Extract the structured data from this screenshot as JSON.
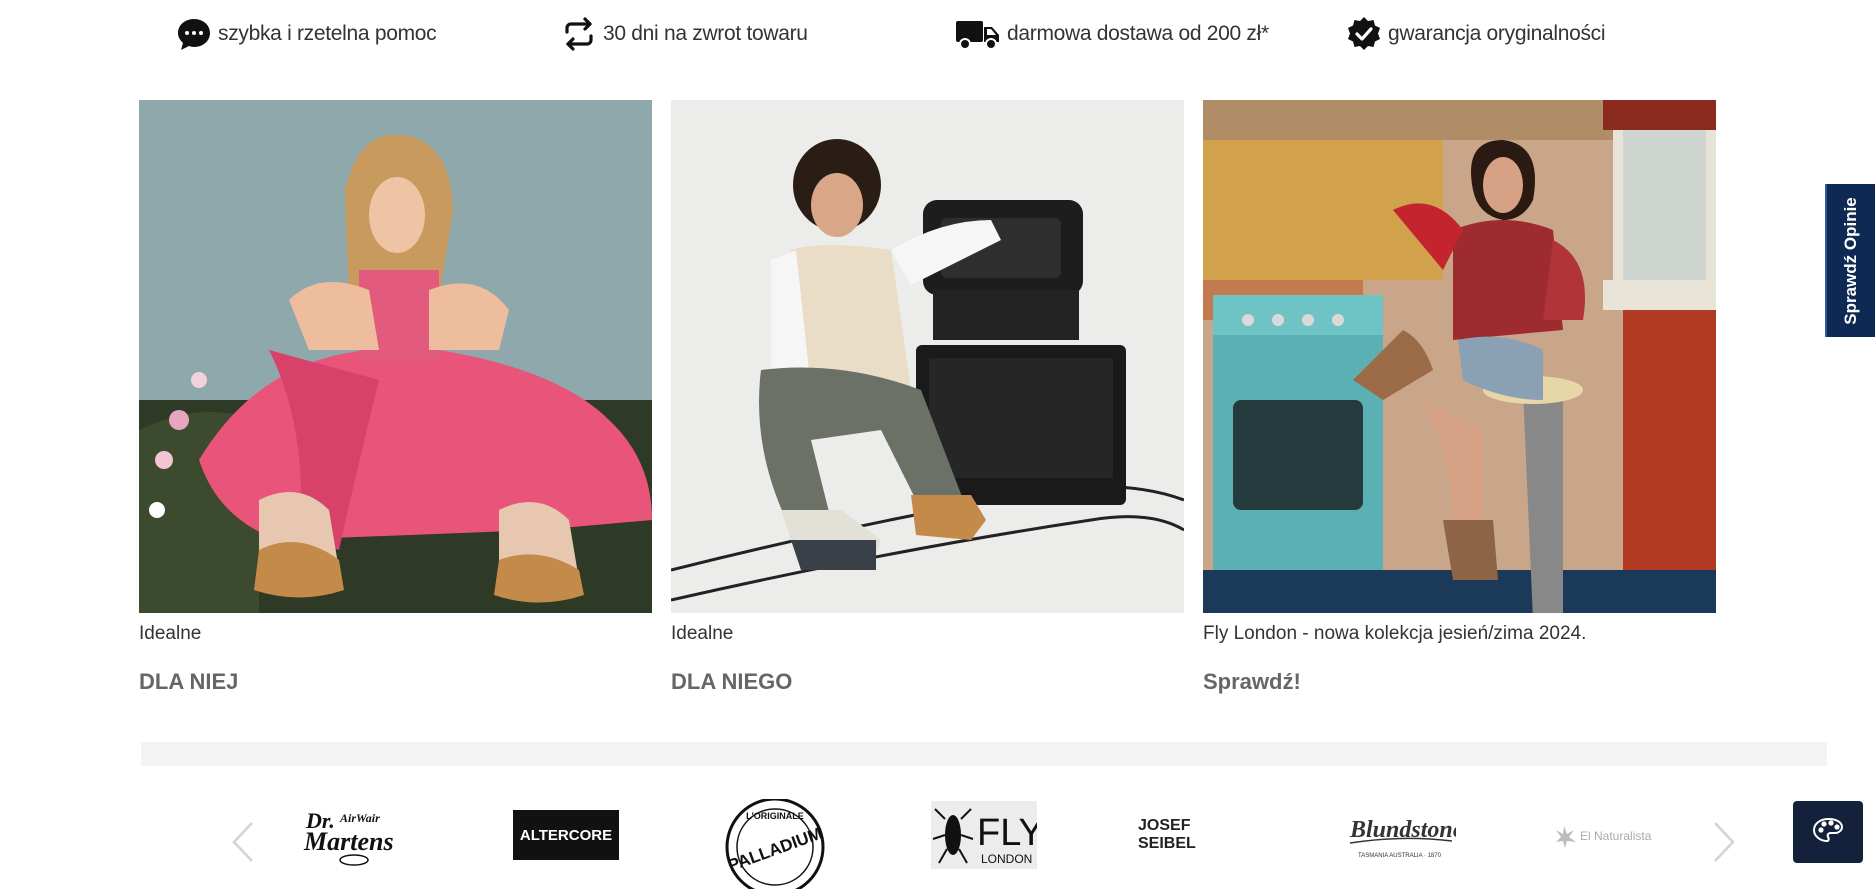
{
  "benefits": [
    {
      "icon": "chat-bubble-icon",
      "label": "szybka i rzetelna pomoc"
    },
    {
      "icon": "return-arrows-icon",
      "label": "30 dni na zwrot towaru"
    },
    {
      "icon": "delivery-truck-icon",
      "label": "darmowa dostawa od 200 zł*"
    },
    {
      "icon": "verified-badge-icon",
      "label": "gwarancja oryginalności"
    }
  ],
  "cards": [
    {
      "subtitle": "Idealne",
      "heading": "DLA NIEJ"
    },
    {
      "subtitle": "Idealne",
      "heading": "DLA NIEGO"
    },
    {
      "subtitle": "Fly London - nowa kolekcja jesień/zima 2024.",
      "heading": "Sprawdź!"
    }
  ],
  "brands": {
    "logos": [
      {
        "name": "dr-martens",
        "text_top": "Dr.",
        "text_main": "Martens",
        "text_small": "AirWair"
      },
      {
        "name": "altercore",
        "text": "ALTERCORE"
      },
      {
        "name": "palladium",
        "text": "PALLADIUM",
        "text_ring": "L'ORIGINALE"
      },
      {
        "name": "fly-london",
        "text": "FLY",
        "text_sub": "LONDON"
      },
      {
        "name": "josef-seibel",
        "text": "JOSEF SEIBEL"
      },
      {
        "name": "blundstone",
        "text": "Blundstone",
        "text_sub": "TASMANIA AUSTRALIA · 1870"
      },
      {
        "name": "el-naturalista",
        "text": "El Naturalista"
      }
    ]
  },
  "reviews_tab": {
    "label": "Sprawdź Opinie"
  },
  "colors": {
    "accent_dark": "#0e2a54",
    "heading_gray": "#666666"
  }
}
